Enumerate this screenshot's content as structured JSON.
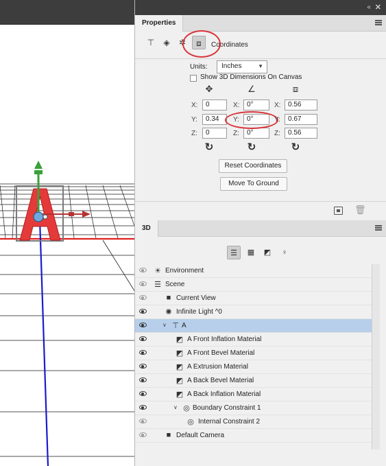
{
  "panel_stack": {
    "collapse_glyph": "‹‹",
    "close_glyph": "✕"
  },
  "properties": {
    "tab_label": "Properties",
    "mode_icons": [
      "mesh-icon",
      "deform-icon",
      "cap-icon",
      "coordinates-icon"
    ],
    "mode_label": "Coordinates",
    "units_label": "Units:",
    "units_value": "Inches",
    "show_dims_label": "Show 3D Dimensions On Canvas",
    "position": {
      "x_label": "X:",
      "x_value": "0",
      "y_label": "Y:",
      "y_value": "0.34",
      "z_label": "Z:",
      "z_value": "0"
    },
    "rotation": {
      "x_label": "X:",
      "x_value": "0°",
      "y_label": "Y:",
      "y_value": "0°",
      "z_label": "Z:",
      "z_value": "0°"
    },
    "scale": {
      "x_label": "X:",
      "x_value": "0.56",
      "y_label": "Y:",
      "y_value": "0.67",
      "z_label": "Z:",
      "z_value": "0.56"
    },
    "reset_glyph": "↻",
    "reset_coordinates_label": "Reset Coordinates",
    "move_to_ground_label": "Move To Ground"
  },
  "panel3d": {
    "tab_label": "3D",
    "filters": [
      "scene-filter-icon",
      "mesh-filter-icon",
      "material-filter-icon",
      "light-filter-icon"
    ],
    "layers": [
      {
        "label": "Environment",
        "visible": false,
        "icon": "environment-icon",
        "indent": 0
      },
      {
        "label": "Scene",
        "visible": false,
        "icon": "scene-icon",
        "indent": 0
      },
      {
        "label": "Current View",
        "visible": false,
        "icon": "camera-icon",
        "indent": 1
      },
      {
        "label": "Infinite Light ^0",
        "visible": true,
        "icon": "light-icon",
        "indent": 1
      },
      {
        "label": "A",
        "visible": true,
        "icon": "mesh-icon",
        "indent": 1,
        "expanded": true,
        "selected": true
      },
      {
        "label": "A Front Inflation Material",
        "visible": true,
        "icon": "material-icon",
        "indent": 2
      },
      {
        "label": "A Front Bevel Material",
        "visible": true,
        "icon": "material-icon",
        "indent": 2
      },
      {
        "label": "A Extrusion Material",
        "visible": true,
        "icon": "material-icon",
        "indent": 2
      },
      {
        "label": "A Back Bevel Material",
        "visible": true,
        "icon": "material-icon",
        "indent": 2
      },
      {
        "label": "A Back Inflation Material",
        "visible": true,
        "icon": "material-icon",
        "indent": 2
      },
      {
        "label": "Boundary Constraint 1",
        "visible": true,
        "icon": "constraint-icon",
        "indent": 2,
        "expanded": true
      },
      {
        "label": "Internal Constraint 2",
        "visible": false,
        "icon": "constraint-icon",
        "indent": 3
      },
      {
        "label": "Default Camera",
        "visible": false,
        "icon": "camera-icon",
        "indent": 1
      }
    ]
  },
  "colors": {
    "panel_bg": "#f0f0f0",
    "selection": "#b7cfea",
    "highlight_ring": "#d9343a",
    "letter_red": "#e53a3a",
    "ground_line": "#e02020",
    "axis_blue": "#1a1acc",
    "gizmo_green": "#3aa03a"
  }
}
